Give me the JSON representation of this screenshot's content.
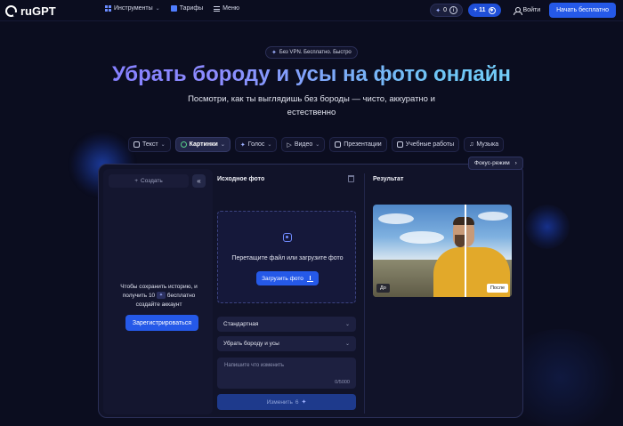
{
  "header": {
    "logo_text": "ruGPT",
    "nav": [
      {
        "label": "Инструменты",
        "icon": "grid-icon"
      },
      {
        "label": "Тарифы",
        "icon": "tag-icon"
      },
      {
        "label": "Меню",
        "icon": "menu-icon"
      }
    ],
    "credits": "0",
    "info_symbol": "i",
    "bonus": "+ 11",
    "login_label": "Войти",
    "start_label": "Начать бесплатно"
  },
  "hero": {
    "badge": "Без VPN. Бесплатно. Быстро",
    "title": "Убрать бороду и усы на фото онлайн",
    "subtitle": "Посмотри, как ты выглядишь без бороды — чисто, аккуратно и естественно"
  },
  "categories": [
    {
      "label": "Текст",
      "active": false
    },
    {
      "label": "Картинки",
      "active": true
    },
    {
      "label": "Голос",
      "active": false
    },
    {
      "label": "Видео",
      "active": false
    },
    {
      "label": "Презентации",
      "active": false
    },
    {
      "label": "Учебные работы",
      "active": false
    },
    {
      "label": "Музыка",
      "active": false
    }
  ],
  "focus_mode": "Фокус-режим",
  "sidebar": {
    "create_label": "Создать",
    "save_text_1": "Чтобы сохранить историю, и получить 10",
    "save_text_2": "бесплатно создайте аккаунт",
    "register_label": "Зарегистрироваться"
  },
  "source": {
    "title": "Исходное фото",
    "drop_text": "Перетащите файл или загрузите фото",
    "upload_label": "Загрузить фото",
    "mode_select": "Стандартная",
    "action_select": "Убрать бороду и усы",
    "prompt_placeholder": "Напишите что изменить",
    "prompt_count": "0/5000",
    "change_label": "Изменить",
    "change_cost": "6"
  },
  "result": {
    "title": "Результат",
    "before_label": "До",
    "after_label": "После"
  },
  "colors": {
    "background": "#0b0d1f",
    "accent": "#2559e8",
    "title_gradient_start": "#7f74ff",
    "title_gradient_end": "#78d6ff"
  }
}
